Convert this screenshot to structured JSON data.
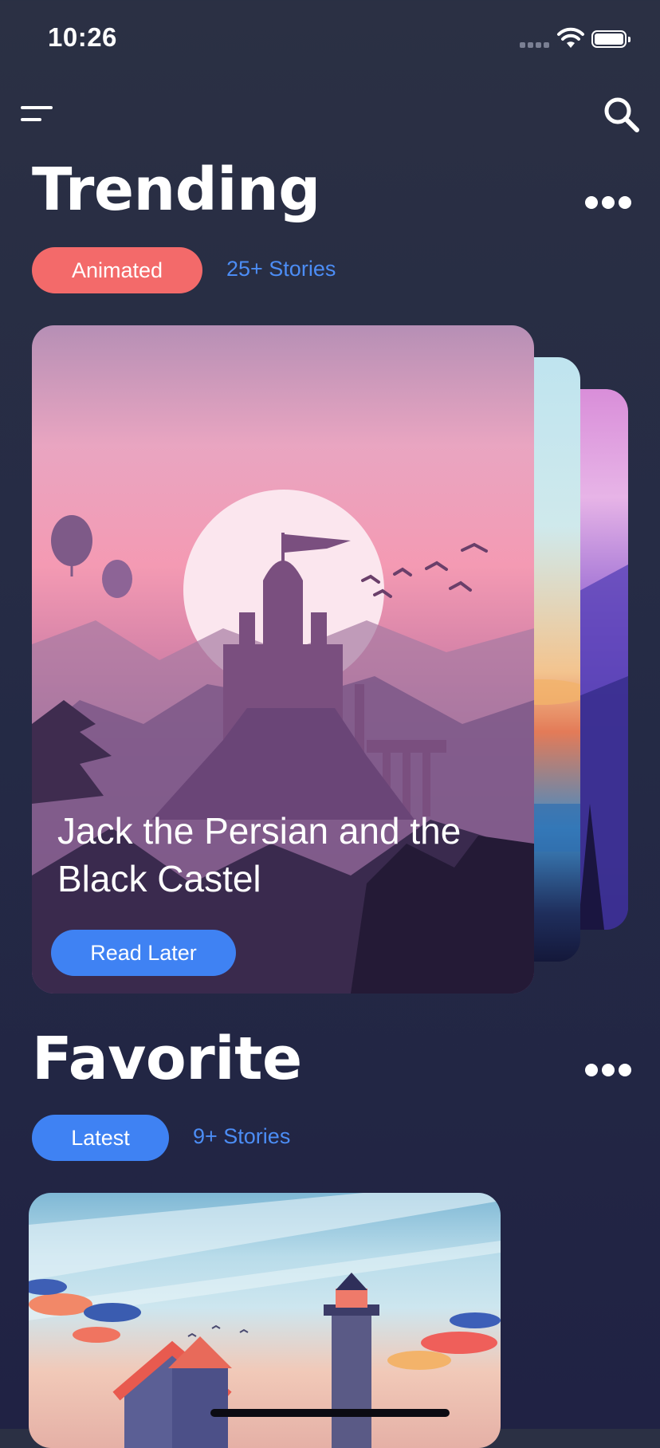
{
  "status_bar": {
    "time": "10:26"
  },
  "trending": {
    "title": "Trending",
    "tag": "Animated",
    "count": "25+ Stories",
    "featured_card": {
      "title": "Jack the Persian and the Black Castel",
      "button": "Read Later"
    }
  },
  "favorite": {
    "title": "Favorite",
    "tag": "Latest",
    "count": "9+ Stories"
  },
  "colors": {
    "background": "#252b45",
    "accent_coral": "#f36a6a",
    "accent_blue": "#3f82f3",
    "link_blue": "#4c8df5"
  },
  "icons": [
    "menu-icon",
    "search-icon",
    "more-icon",
    "wifi-icon",
    "battery-icon",
    "cellular-signal-icon"
  ]
}
